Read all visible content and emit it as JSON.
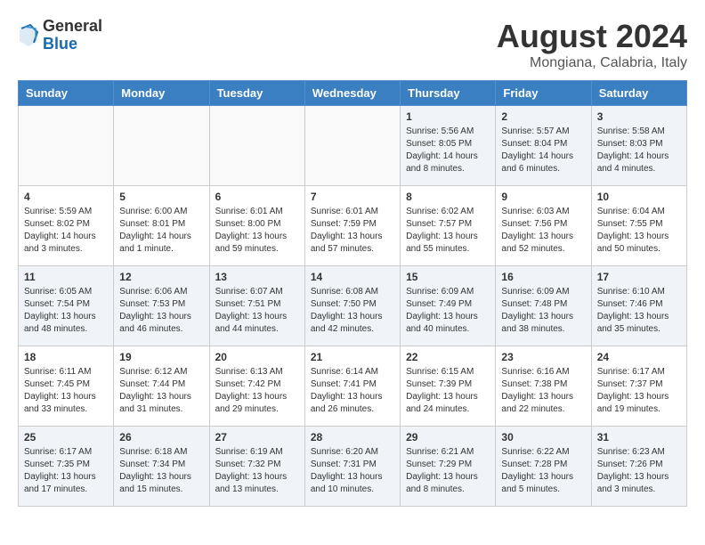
{
  "header": {
    "logo_general": "General",
    "logo_blue": "Blue",
    "month_title": "August 2024",
    "location": "Mongiana, Calabria, Italy"
  },
  "weekdays": [
    "Sunday",
    "Monday",
    "Tuesday",
    "Wednesday",
    "Thursday",
    "Friday",
    "Saturday"
  ],
  "weeks": [
    [
      {
        "day": "",
        "info": ""
      },
      {
        "day": "",
        "info": ""
      },
      {
        "day": "",
        "info": ""
      },
      {
        "day": "",
        "info": ""
      },
      {
        "day": "1",
        "info": "Sunrise: 5:56 AM\nSunset: 8:05 PM\nDaylight: 14 hours\nand 8 minutes."
      },
      {
        "day": "2",
        "info": "Sunrise: 5:57 AM\nSunset: 8:04 PM\nDaylight: 14 hours\nand 6 minutes."
      },
      {
        "day": "3",
        "info": "Sunrise: 5:58 AM\nSunset: 8:03 PM\nDaylight: 14 hours\nand 4 minutes."
      }
    ],
    [
      {
        "day": "4",
        "info": "Sunrise: 5:59 AM\nSunset: 8:02 PM\nDaylight: 14 hours\nand 3 minutes."
      },
      {
        "day": "5",
        "info": "Sunrise: 6:00 AM\nSunset: 8:01 PM\nDaylight: 14 hours\nand 1 minute."
      },
      {
        "day": "6",
        "info": "Sunrise: 6:01 AM\nSunset: 8:00 PM\nDaylight: 13 hours\nand 59 minutes."
      },
      {
        "day": "7",
        "info": "Sunrise: 6:01 AM\nSunset: 7:59 PM\nDaylight: 13 hours\nand 57 minutes."
      },
      {
        "day": "8",
        "info": "Sunrise: 6:02 AM\nSunset: 7:57 PM\nDaylight: 13 hours\nand 55 minutes."
      },
      {
        "day": "9",
        "info": "Sunrise: 6:03 AM\nSunset: 7:56 PM\nDaylight: 13 hours\nand 52 minutes."
      },
      {
        "day": "10",
        "info": "Sunrise: 6:04 AM\nSunset: 7:55 PM\nDaylight: 13 hours\nand 50 minutes."
      }
    ],
    [
      {
        "day": "11",
        "info": "Sunrise: 6:05 AM\nSunset: 7:54 PM\nDaylight: 13 hours\nand 48 minutes."
      },
      {
        "day": "12",
        "info": "Sunrise: 6:06 AM\nSunset: 7:53 PM\nDaylight: 13 hours\nand 46 minutes."
      },
      {
        "day": "13",
        "info": "Sunrise: 6:07 AM\nSunset: 7:51 PM\nDaylight: 13 hours\nand 44 minutes."
      },
      {
        "day": "14",
        "info": "Sunrise: 6:08 AM\nSunset: 7:50 PM\nDaylight: 13 hours\nand 42 minutes."
      },
      {
        "day": "15",
        "info": "Sunrise: 6:09 AM\nSunset: 7:49 PM\nDaylight: 13 hours\nand 40 minutes."
      },
      {
        "day": "16",
        "info": "Sunrise: 6:09 AM\nSunset: 7:48 PM\nDaylight: 13 hours\nand 38 minutes."
      },
      {
        "day": "17",
        "info": "Sunrise: 6:10 AM\nSunset: 7:46 PM\nDaylight: 13 hours\nand 35 minutes."
      }
    ],
    [
      {
        "day": "18",
        "info": "Sunrise: 6:11 AM\nSunset: 7:45 PM\nDaylight: 13 hours\nand 33 minutes."
      },
      {
        "day": "19",
        "info": "Sunrise: 6:12 AM\nSunset: 7:44 PM\nDaylight: 13 hours\nand 31 minutes."
      },
      {
        "day": "20",
        "info": "Sunrise: 6:13 AM\nSunset: 7:42 PM\nDaylight: 13 hours\nand 29 minutes."
      },
      {
        "day": "21",
        "info": "Sunrise: 6:14 AM\nSunset: 7:41 PM\nDaylight: 13 hours\nand 26 minutes."
      },
      {
        "day": "22",
        "info": "Sunrise: 6:15 AM\nSunset: 7:39 PM\nDaylight: 13 hours\nand 24 minutes."
      },
      {
        "day": "23",
        "info": "Sunrise: 6:16 AM\nSunset: 7:38 PM\nDaylight: 13 hours\nand 22 minutes."
      },
      {
        "day": "24",
        "info": "Sunrise: 6:17 AM\nSunset: 7:37 PM\nDaylight: 13 hours\nand 19 minutes."
      }
    ],
    [
      {
        "day": "25",
        "info": "Sunrise: 6:17 AM\nSunset: 7:35 PM\nDaylight: 13 hours\nand 17 minutes."
      },
      {
        "day": "26",
        "info": "Sunrise: 6:18 AM\nSunset: 7:34 PM\nDaylight: 13 hours\nand 15 minutes."
      },
      {
        "day": "27",
        "info": "Sunrise: 6:19 AM\nSunset: 7:32 PM\nDaylight: 13 hours\nand 13 minutes."
      },
      {
        "day": "28",
        "info": "Sunrise: 6:20 AM\nSunset: 7:31 PM\nDaylight: 13 hours\nand 10 minutes."
      },
      {
        "day": "29",
        "info": "Sunrise: 6:21 AM\nSunset: 7:29 PM\nDaylight: 13 hours\nand 8 minutes."
      },
      {
        "day": "30",
        "info": "Sunrise: 6:22 AM\nSunset: 7:28 PM\nDaylight: 13 hours\nand 5 minutes."
      },
      {
        "day": "31",
        "info": "Sunrise: 6:23 AM\nSunset: 7:26 PM\nDaylight: 13 hours\nand 3 minutes."
      }
    ]
  ]
}
